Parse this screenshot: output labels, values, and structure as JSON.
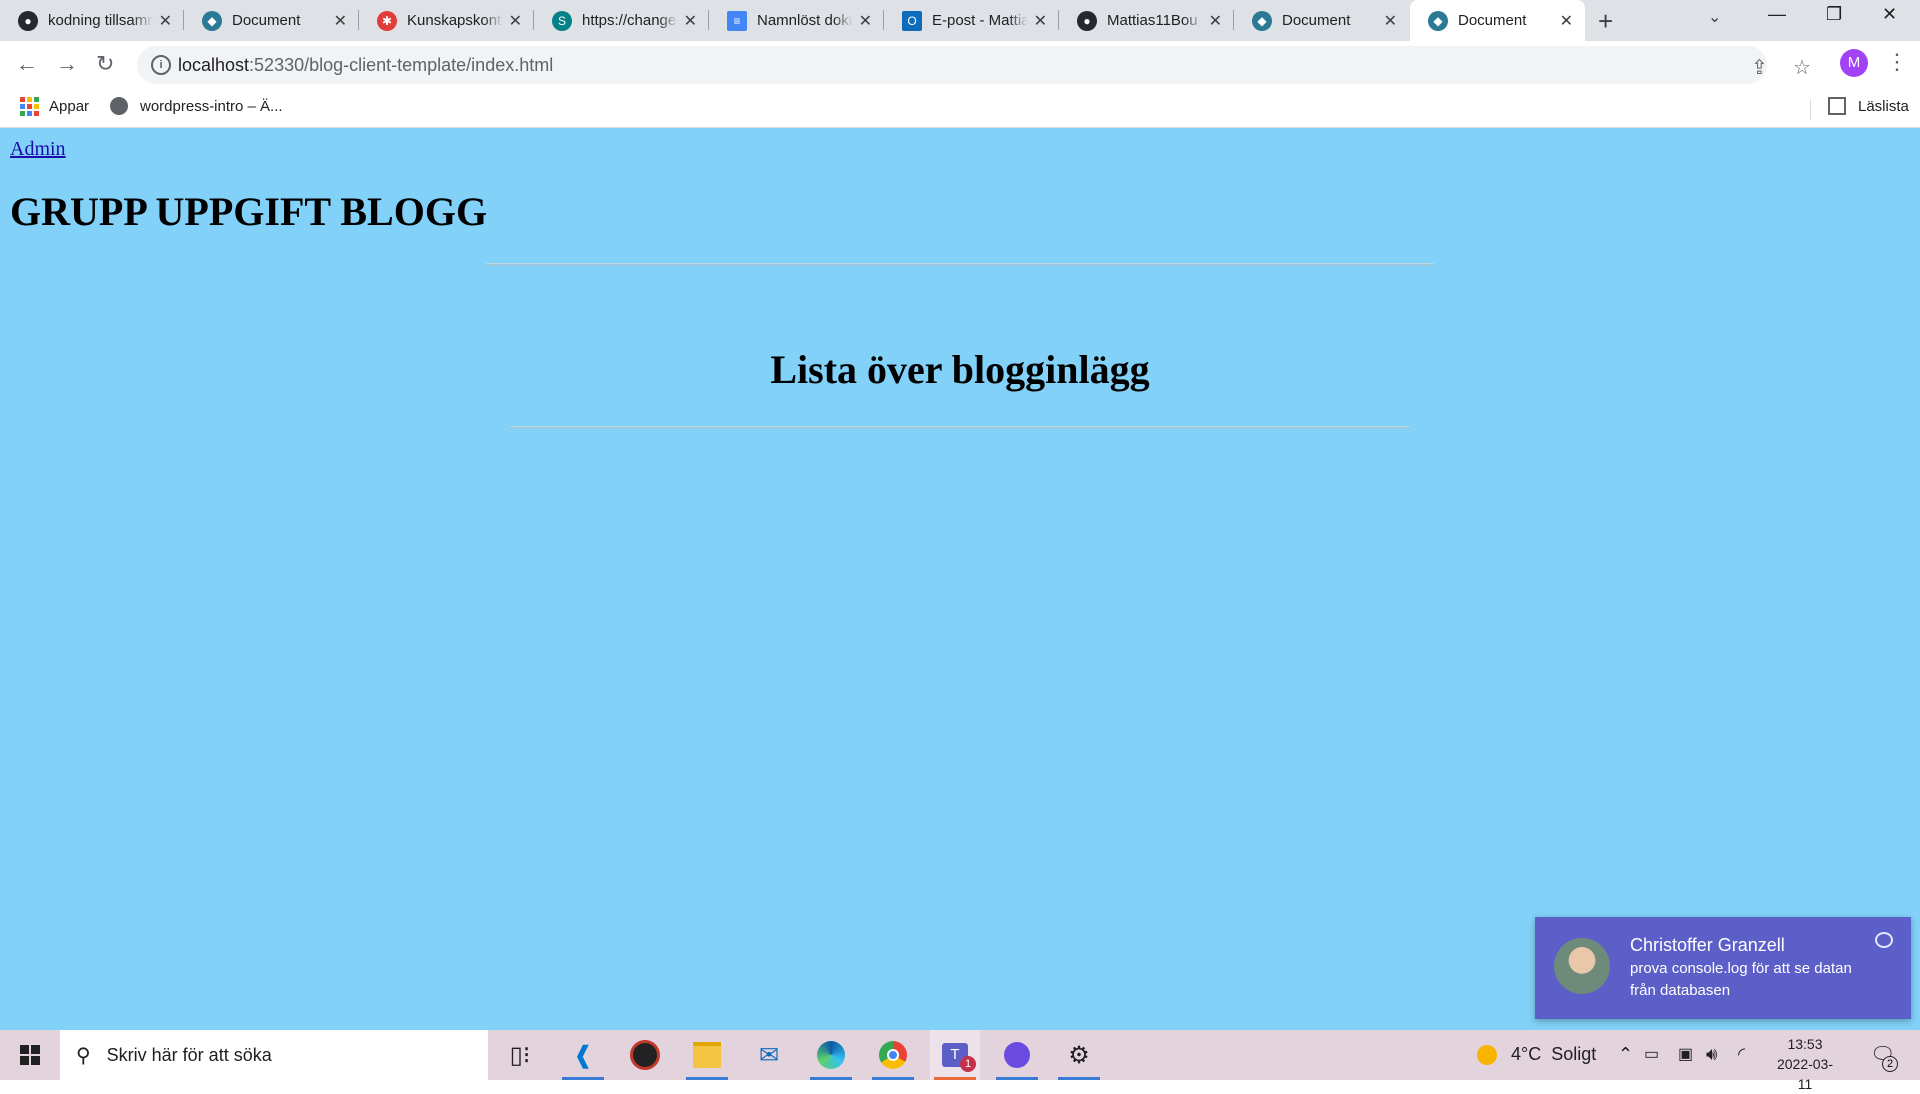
{
  "browser": {
    "tabs": [
      {
        "label": "kodning tillsammans",
        "icon": "github-icon",
        "color": "#24292f"
      },
      {
        "label": "Document",
        "icon": "vscode-live-icon",
        "color": "#2b7a95"
      },
      {
        "label": "Kunskapskontroll",
        "icon": "asterisk-icon",
        "color": "#e03c3c"
      },
      {
        "label": "https://change",
        "icon": "sharepoint-icon",
        "color": "#038387"
      },
      {
        "label": "Namnlöst dokument",
        "icon": "google-docs-icon",
        "color": "#4285f4"
      },
      {
        "label": "E-post - Mattias",
        "icon": "outlook-icon",
        "color": "#0f6cbd"
      },
      {
        "label": "Mattias11Bou",
        "icon": "github-icon",
        "color": "#24292f"
      },
      {
        "label": "Document",
        "icon": "vscode-live-icon",
        "color": "#2b7a95"
      },
      {
        "label": "Document",
        "icon": "vscode-live-icon",
        "color": "#2b7a95",
        "active": true
      }
    ],
    "address": {
      "host": "localhost",
      "path": ":52330/blog-client-template/index.html"
    },
    "profile_initial": "M",
    "bookmarks": [
      {
        "label": "Appar",
        "icon": "apps-grid-icon"
      },
      {
        "label": "wordpress-intro – Ä...",
        "icon": "globe-icon"
      }
    ],
    "reading_list": "Läslista"
  },
  "page": {
    "admin_link": "Admin",
    "site_title": "GRUPP UPPGIFT BLOGG",
    "list_title": "Lista över blogginlägg",
    "background": "#81d1f9"
  },
  "toast": {
    "sender": "Christoffer Granzell",
    "message": "prova console.log för att se datan från databasen",
    "color": "#5b5fc7"
  },
  "taskbar": {
    "search_placeholder": "Skriv här för att söka",
    "weather": {
      "temp": "4°C",
      "condition": "Soligt"
    },
    "time": "13:53",
    "date": "2022-03-11",
    "notification_count": "2",
    "teams_badge": "1"
  }
}
